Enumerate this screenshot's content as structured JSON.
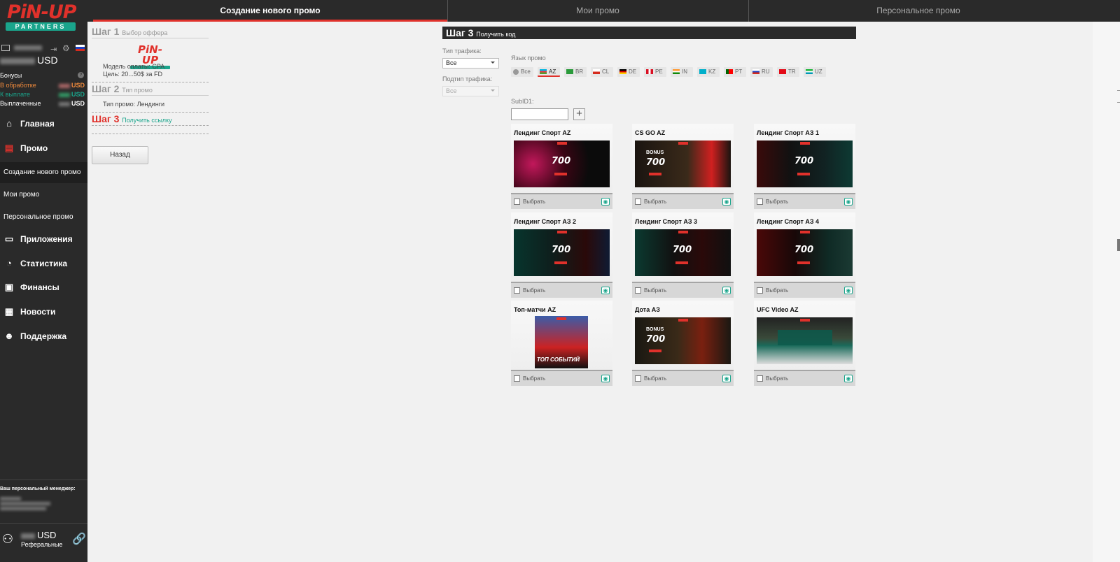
{
  "brand": {
    "name": "PiN-UP",
    "sub": "PARTNERS"
  },
  "sidebar": {
    "currency": "USD",
    "bonuses_label": "Бонусы",
    "help": "?",
    "processing_label": "В обработке",
    "payout_label": "К выплате",
    "paid_label": "Выплаченные",
    "nav": [
      {
        "label": "Главная",
        "icon": "home-icon"
      },
      {
        "label": "Промо",
        "icon": "document-icon"
      },
      {
        "label": "Приложения",
        "icon": "app-icon"
      },
      {
        "label": "Статистика",
        "icon": "pie-chart-icon"
      },
      {
        "label": "Финансы",
        "icon": "finance-icon"
      },
      {
        "label": "Новости",
        "icon": "news-icon"
      },
      {
        "label": "Поддержка",
        "icon": "support-icon"
      }
    ],
    "sub": [
      "Создание нового промо",
      "Мои промо",
      "Персональное промо"
    ],
    "manager_label": "Ваш персональный менеджер:",
    "footer": {
      "currency": "USD",
      "label": "Реферальные"
    }
  },
  "tabs": [
    "Создание нового промо",
    "Мои промо",
    "Персональное промо"
  ],
  "steps": {
    "s1": {
      "title": "Шаг 1",
      "caption": "Выбор оффера",
      "logo": "PiN-UP",
      "model": "Модель оплаты: CPA",
      "goal": "Цель: 20...50$ за FD"
    },
    "s2": {
      "title": "Шаг 2",
      "caption": "Тип промо",
      "type": "Тип промо: Лендинги"
    },
    "s3": {
      "title": "Шаг 3",
      "caption": "Получить ссылку"
    },
    "back": "Назад"
  },
  "main": {
    "title": "Шаг 3",
    "caption": "Получить код",
    "traffic_label": "Тип трафика:",
    "traffic_value": "Все",
    "subtype_label": "Подтип трафика:",
    "subtype_value": "Все",
    "lang_label": "Язык промо",
    "langs": [
      "Все",
      "AZ",
      "BR",
      "CL",
      "DE",
      "PE",
      "IN",
      "KZ",
      "PT",
      "RU",
      "TR",
      "UZ"
    ],
    "subid_label": "SubID1:",
    "plus": "+",
    "choose": "Выбрать",
    "cards": [
      "Лендинг Спорт AZ",
      "CS GO AZ",
      "Лендинг Спорт АЗ 1",
      "Лендинг Спорт АЗ 2",
      "Лендинг Спорт АЗ 3",
      "Лендинг Спорт АЗ 4",
      "Топ-матчи AZ",
      "Дота АЗ",
      "UFC Video AZ"
    ],
    "bonus_text": "700",
    "bonus_word": "BONUS",
    "top_events": "ТОП СОБЫТИЙ"
  }
}
